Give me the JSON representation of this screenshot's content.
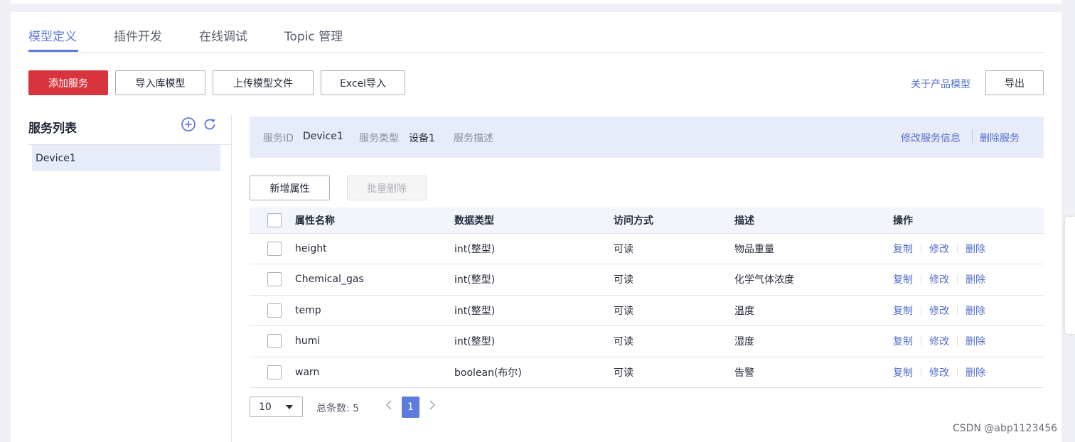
{
  "tabs": [
    {
      "label": "模型定义"
    },
    {
      "label": "插件开发"
    },
    {
      "label": "在线调试"
    },
    {
      "label": "Topic 管理"
    }
  ],
  "toolbar": {
    "add_service": "添加服务",
    "import_library": "导入库模型",
    "upload_file": "上传模型文件",
    "excel_import": "Excel导入",
    "about_model": "关于产品模型",
    "export": "导出"
  },
  "service_list": {
    "title": "服务列表",
    "items": [
      {
        "label": "Device1"
      }
    ]
  },
  "service_info": {
    "id_label": "服务ID",
    "id_value": "Device1",
    "type_label": "服务类型",
    "type_value": "设备1",
    "desc_label": "服务描述",
    "edit_link": "修改服务信息",
    "delete_link": "删除服务"
  },
  "property_actions": {
    "add": "新增属性",
    "batch_delete": "批量删除"
  },
  "table": {
    "headers": [
      "属性名称",
      "数据类型",
      "访问方式",
      "描述",
      "操作"
    ],
    "rows": [
      {
        "name": "height",
        "type": "int(整型)",
        "access": "可读",
        "desc": "物品重量"
      },
      {
        "name": "Chemical_gas",
        "type": "int(整型)",
        "access": "可读",
        "desc": "化学气体浓度"
      },
      {
        "name": "temp",
        "type": "int(整型)",
        "access": "可读",
        "desc": "温度"
      },
      {
        "name": "humi",
        "type": "int(整型)",
        "access": "可读",
        "desc": "湿度"
      },
      {
        "name": "warn",
        "type": "boolean(布尔)",
        "access": "可读",
        "desc": "告警"
      }
    ],
    "ops": {
      "copy": "复制",
      "edit": "修改",
      "delete": "删除"
    }
  },
  "pagination": {
    "page_size": "10",
    "total_label": "总条数:",
    "total": "5",
    "current_page": "1"
  },
  "watermark": "CSDN @abp1123456",
  "colors": {
    "primary_red": "#d7343e",
    "accent_blue": "#5e7ce0",
    "link_blue": "#526ecc",
    "info_bg": "#e8ecf9"
  }
}
